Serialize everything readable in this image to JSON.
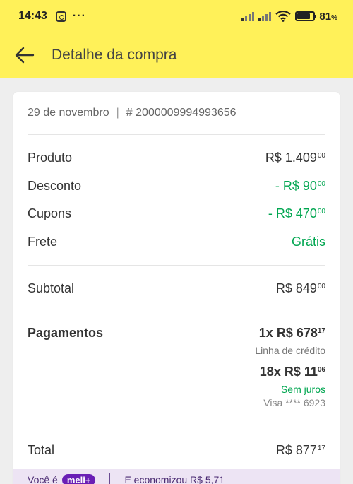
{
  "status_bar": {
    "time": "14:43",
    "dots": "···",
    "battery_pct": "81",
    "battery_unit": "%"
  },
  "app_bar": {
    "title": "Detalhe da compra"
  },
  "order": {
    "date": "29 de novembro",
    "separator": "|",
    "number": "# 2000009994993656"
  },
  "lines": [
    {
      "label": "Produto",
      "value": "R$ 1.409",
      "cents": "00"
    },
    {
      "label": "Desconto",
      "value": "- R$ 90",
      "cents": "00"
    },
    {
      "label": "Cupons",
      "value": "- R$ 470",
      "cents": "00"
    },
    {
      "label": "Frete",
      "value": "Grátis",
      "cents": ""
    }
  ],
  "subtotal": {
    "label": "Subtotal",
    "value": "R$ 849",
    "cents": "00"
  },
  "payments": {
    "title": "Pagamentos",
    "items": [
      {
        "amount": "1x R$ 678",
        "cents": "17",
        "detail": "Linha de crédito"
      },
      {
        "amount": "18x R$ 11",
        "cents": "06",
        "detail": "Sem juros",
        "card": "Visa **** 6923"
      }
    ]
  },
  "total": {
    "label": "Total",
    "value": "R$ 877",
    "cents": "17"
  },
  "meli_strip": {
    "prefix": "Você é",
    "badge": "meli+",
    "savings": "E economizou R$ 5,71"
  },
  "colors": {
    "header_yellow": "#fff159",
    "green": "#00a650",
    "meli_purple": "#6a1fb5"
  }
}
